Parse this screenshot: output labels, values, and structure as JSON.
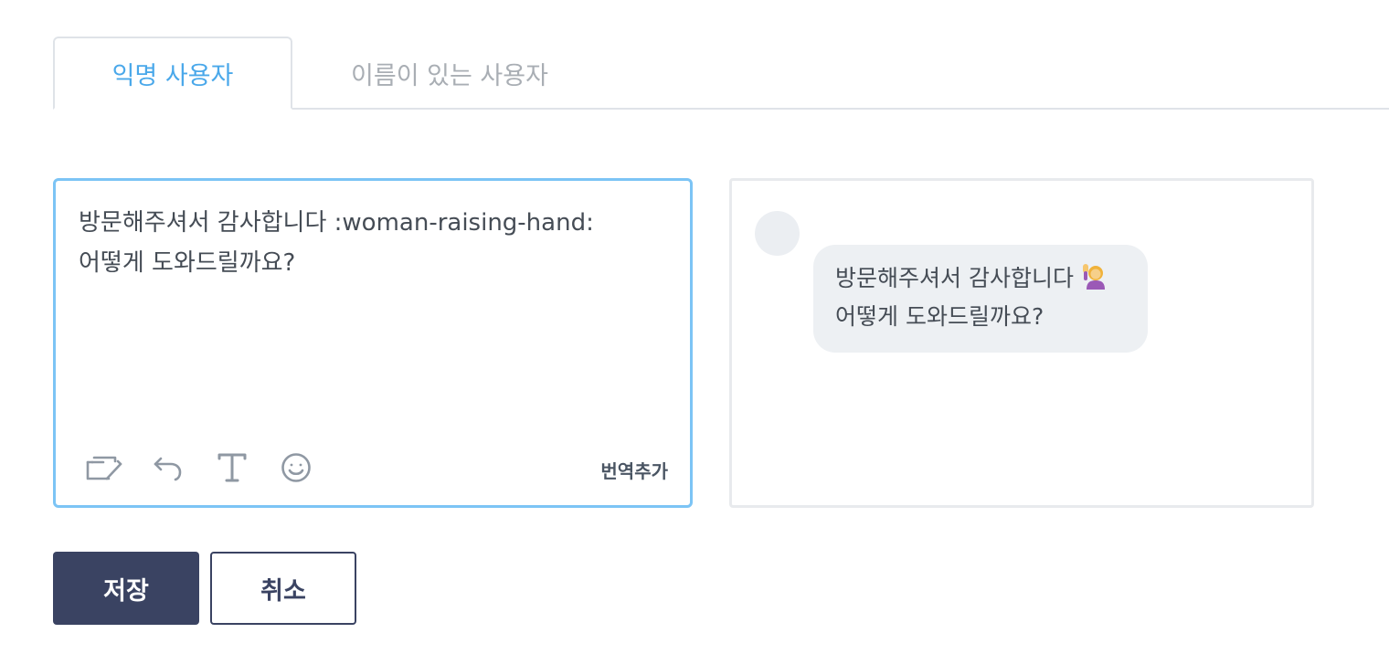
{
  "tabs": [
    {
      "label": "익명 사용자",
      "active": true
    },
    {
      "label": "이름이 있는 사용자",
      "active": false
    }
  ],
  "editor": {
    "text": "방문해주셔서 감사합니다 :woman-raising-hand:\n어떻게 도와드릴까요?",
    "toolbar_icons": [
      "template-icon",
      "undo-icon",
      "text-format-icon",
      "emoji-icon"
    ],
    "translate_label": "번역추가"
  },
  "preview": {
    "line1": "방문해주셔서 감사합니다",
    "line2": "어떻게 도와드릴까요?",
    "emoji_icon": "woman-raising-hand-icon"
  },
  "buttons": {
    "save_label": "저장",
    "cancel_label": "취소"
  },
  "colors": {
    "active_tab": "#4aa8ea",
    "editor_focus_border": "#7cc4f5",
    "primary_button": "#3a4362",
    "bubble_background": "#edf0f3"
  }
}
